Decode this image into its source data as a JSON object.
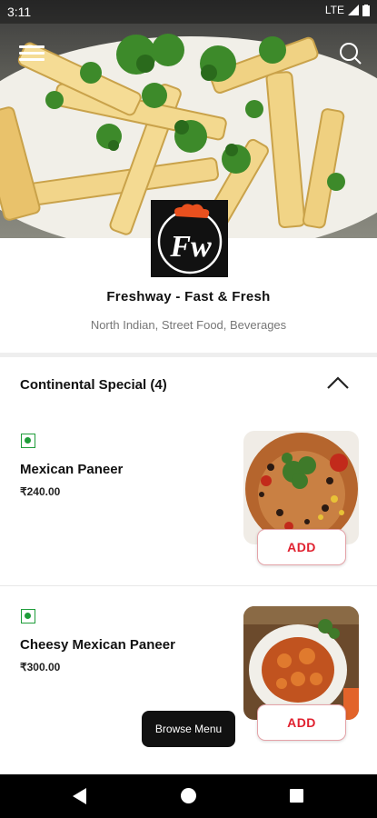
{
  "status_bar": {
    "time": "3:11",
    "network": "LTE"
  },
  "restaurant": {
    "logo_text": "Fw",
    "name": "Freshway - Fast & Fresh",
    "cuisine": "North Indian, Street Food, Beverages"
  },
  "section": {
    "title": "Continental Special (4)"
  },
  "items": [
    {
      "name": "Mexican Paneer",
      "price": "₹240.00",
      "add_label": "ADD",
      "veg": true
    },
    {
      "name": "Cheesy Mexican Paneer",
      "price": "₹300.00",
      "add_label": "ADD",
      "veg": true
    }
  ],
  "browse_menu_label": "Browse Menu",
  "colors": {
    "accent": "#e0212f",
    "veg": "#1f9d3a",
    "logo_bg": "#111111"
  },
  "icons": [
    "menu-icon",
    "search-icon",
    "chevron-up-icon",
    "back-icon",
    "home-icon",
    "recents-icon"
  ]
}
